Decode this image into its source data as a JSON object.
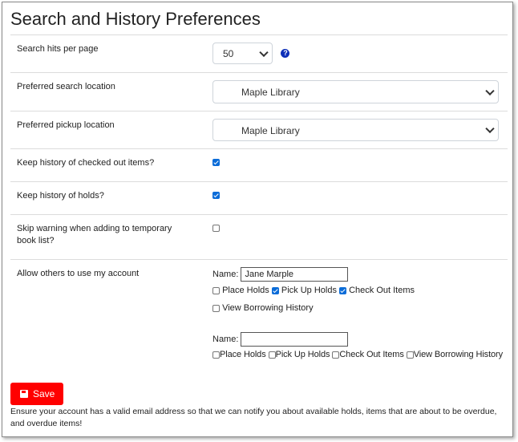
{
  "page": {
    "title": "Search and History Preferences"
  },
  "prefs": {
    "hits_per_page": {
      "label": "Search hits per page",
      "value": "50",
      "help": "?"
    },
    "search_location": {
      "label": "Preferred search location",
      "value": "Maple Library"
    },
    "pickup_location": {
      "label": "Preferred pickup location",
      "value": "Maple Library"
    },
    "history_checkout": {
      "label": "Keep history of checked out items?",
      "checked": true
    },
    "history_holds": {
      "label": "Keep history of holds?",
      "checked": true
    },
    "skip_warning": {
      "label": "Skip warning when adding to temporary book list?",
      "checked": false
    },
    "allow_others": {
      "label": "Allow others to use my account"
    }
  },
  "proxy1": {
    "name_label": "Name:",
    "name_value": "Jane Marple",
    "place_holds": "Place Holds",
    "pick_up_holds": "Pick Up Holds",
    "check_out_items": "Check Out Items",
    "view_borrowing_history": "View Borrowing History",
    "checks": {
      "place_holds": false,
      "pick_up_holds": true,
      "check_out_items": true,
      "view_borrowing_history": false
    }
  },
  "proxy2": {
    "name_label": "Name:",
    "name_value": "",
    "place_holds": "Place Holds",
    "pick_up_holds": "Pick Up Holds",
    "check_out_items": "Check Out Items",
    "view_borrowing_history": "View Borrowing History"
  },
  "save": {
    "label": "Save"
  },
  "note": "Ensure your account has a valid email address so that we can notify you about available holds, items that are about to be overdue, and overdue items!"
}
